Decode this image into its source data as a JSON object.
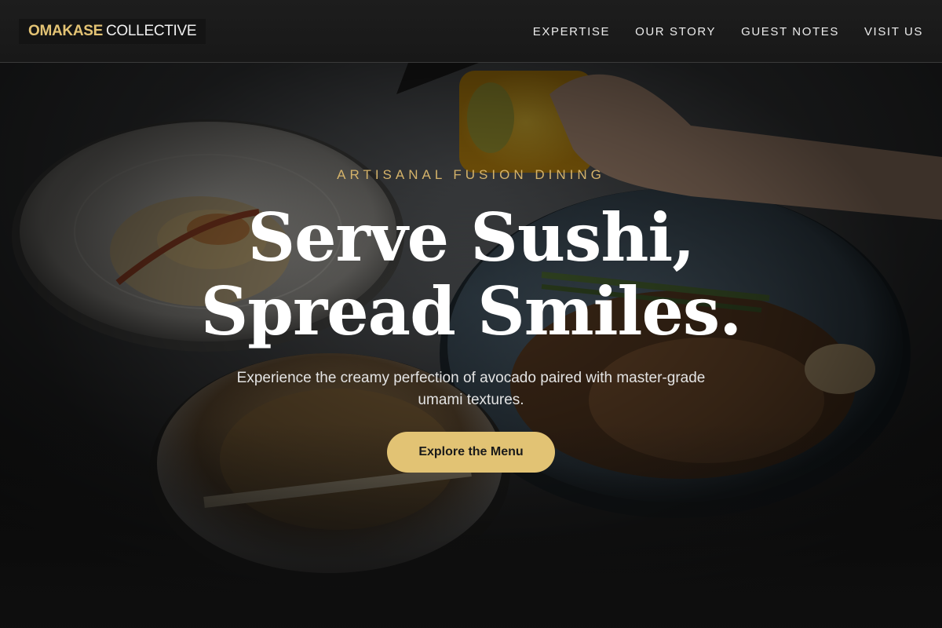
{
  "brand": {
    "name_primary": "OMAKASE",
    "name_secondary": "COLLECTIVE"
  },
  "nav": {
    "items": [
      {
        "label": "EXPERTISE"
      },
      {
        "label": "OUR STORY"
      },
      {
        "label": "GUEST NOTES"
      },
      {
        "label": "VISIT US"
      }
    ]
  },
  "hero": {
    "eyebrow": "ARTISANAL FUSION DINING",
    "title_line1": "Serve Sushi,",
    "title_line2": "Spread Smiles.",
    "subtitle_line1": "Experience the creamy perfection of avocado paired with master-grade",
    "subtitle_line2": "umami textures.",
    "cta_label": "Explore the Menu",
    "background_image": "food-photo"
  },
  "colors": {
    "accent_gold": "#e2c374",
    "header_bg": "#1b1b1b",
    "text_light": "#ffffff"
  }
}
